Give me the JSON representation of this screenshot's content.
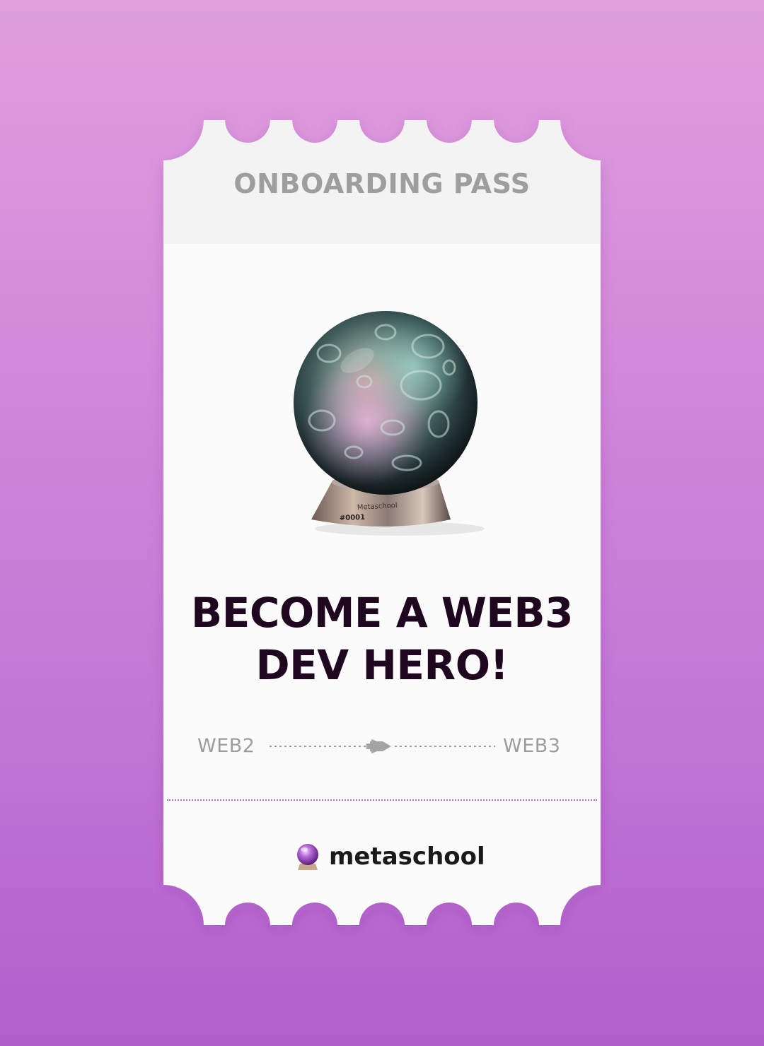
{
  "header": {
    "title": "ONBOARDING PASS"
  },
  "hero": {
    "line1": "BECOME A WEB3",
    "line2": "DEV HERO!",
    "orb_label": "Metaschool",
    "orb_number": "#0001"
  },
  "route": {
    "from": "WEB2",
    "to": "WEB3",
    "vehicle_icon": "rocket-icon"
  },
  "brand": {
    "name": "metaschool",
    "logo_icon": "crystal-ball-icon"
  },
  "colors": {
    "background_top": "#e09fdd",
    "background_bottom": "#b05fcc",
    "ticket": "#fbfbfb",
    "ticket_header": "#f3f3f3",
    "headline": "#1f0720",
    "muted": "#9e9e9e",
    "tear_line": "#b46ac6"
  }
}
